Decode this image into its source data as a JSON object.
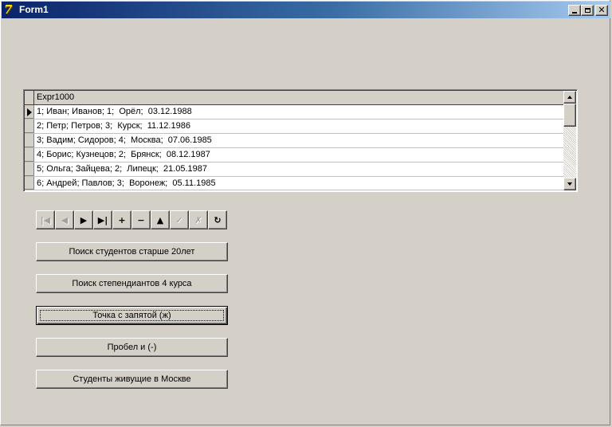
{
  "window": {
    "title": "Form1",
    "icon": "delphi-app-icon"
  },
  "grid": {
    "columns": [
      "Expr1000"
    ],
    "rows": [
      "1; Иван; Иванов; 1;  Орёл;  03.12.1988",
      "2; Петр; Петров; 3;  Курск;  11.12.1986",
      "3; Вадим; Сидоров; 4;  Москва;  07.06.1985",
      "4; Борис; Кузнецов; 2;  Брянск;  08.12.1987",
      "5; Ольга; Зайцева; 2;  Липецк;  21.05.1987",
      "6; Андрей; Павлов; 3;  Воронеж;  05.11.1985"
    ],
    "current_row": 1
  },
  "navigator": {
    "buttons": [
      {
        "name": "first",
        "glyph": "|◀",
        "enabled": false
      },
      {
        "name": "prior",
        "glyph": "◀",
        "enabled": false
      },
      {
        "name": "next",
        "glyph": "▶",
        "enabled": true
      },
      {
        "name": "last",
        "glyph": "▶|",
        "enabled": true
      },
      {
        "name": "insert",
        "glyph": "+",
        "enabled": true
      },
      {
        "name": "delete",
        "glyph": "−",
        "enabled": true
      },
      {
        "name": "edit",
        "glyph": "▲",
        "enabled": true
      },
      {
        "name": "post",
        "glyph": "✓",
        "enabled": false
      },
      {
        "name": "cancel",
        "glyph": "✗",
        "enabled": false
      },
      {
        "name": "refresh",
        "glyph": "↻",
        "enabled": true
      }
    ]
  },
  "buttons": {
    "search_older_20": "Поиск студентов старше 20лет",
    "search_scholarship_4": "Поиск степендиантов 4 курса",
    "semicolon": "Точка с запятой (ж)",
    "space": "Пробел и (-)",
    "moscow": "Студенты живущие в Москве"
  }
}
